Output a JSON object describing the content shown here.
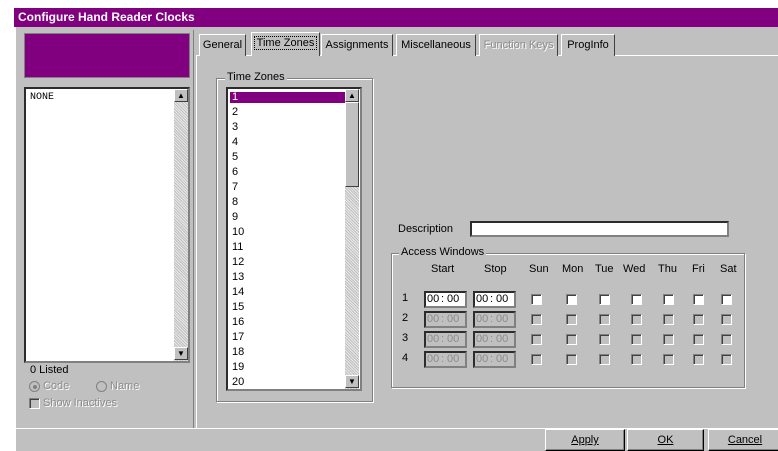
{
  "window": {
    "title": "Configure Hand Reader Clocks"
  },
  "left_panel": {
    "list_item": "NONE",
    "listed_count": "0 Listed",
    "radio_code": "Code",
    "radio_name": "Name",
    "show_inactives": "Show Inactives"
  },
  "tabs": [
    {
      "label": "General"
    },
    {
      "label": "Time Zones"
    },
    {
      "label": "Assignments"
    },
    {
      "label": "Miscellaneous"
    },
    {
      "label": "Function Keys"
    },
    {
      "label": "ProgInfo"
    }
  ],
  "time_zones": {
    "group_label": "Time Zones",
    "items": [
      "1",
      "2",
      "3",
      "4",
      "5",
      "6",
      "7",
      "8",
      "9",
      "10",
      "11",
      "12",
      "13",
      "14",
      "15",
      "16",
      "17",
      "18",
      "19",
      "20"
    ],
    "selected": "1"
  },
  "description": {
    "label": "Description",
    "value": ""
  },
  "access_windows": {
    "group_label": "Access Windows",
    "headers": {
      "start": "Start",
      "stop": "Stop",
      "days": [
        "Sun",
        "Mon",
        "Tue",
        "Wed",
        "Thu",
        "Fri",
        "Sat"
      ]
    },
    "rows": [
      {
        "num": "1",
        "start_h": "00",
        "start_m": "00",
        "stop_h": "00",
        "stop_m": "00"
      },
      {
        "num": "2",
        "start_h": "00",
        "start_m": "00",
        "stop_h": "00",
        "stop_m": "00"
      },
      {
        "num": "3",
        "start_h": "00",
        "start_m": "00",
        "stop_h": "00",
        "stop_m": "00"
      },
      {
        "num": "4",
        "start_h": "00",
        "start_m": "00",
        "stop_h": "00",
        "stop_m": "00"
      }
    ]
  },
  "buttons": {
    "apply": "Apply",
    "ok": "OK",
    "cancel": "Cancel"
  }
}
